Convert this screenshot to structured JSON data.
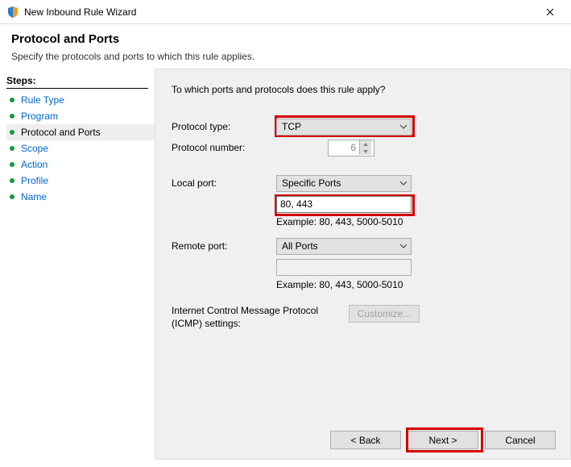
{
  "window": {
    "title": "New Inbound Rule Wizard"
  },
  "header": {
    "title": "Protocol and Ports",
    "subtitle": "Specify the protocols and ports to which this rule applies."
  },
  "sidebar": {
    "title": "Steps:",
    "items": [
      {
        "label": "Rule Type",
        "current": false
      },
      {
        "label": "Program",
        "current": false
      },
      {
        "label": "Protocol and Ports",
        "current": true
      },
      {
        "label": "Scope",
        "current": false
      },
      {
        "label": "Action",
        "current": false
      },
      {
        "label": "Profile",
        "current": false
      },
      {
        "label": "Name",
        "current": false
      }
    ]
  },
  "main": {
    "prompt": "To which ports and protocols does this rule apply?",
    "protocol_type_label": "Protocol type:",
    "protocol_type_value": "TCP",
    "protocol_number_label": "Protocol number:",
    "protocol_number_value": "6",
    "local_port_label": "Local port:",
    "local_port_mode": "Specific Ports",
    "local_port_value": "80, 443",
    "local_port_example": "Example: 80, 443, 5000-5010",
    "remote_port_label": "Remote port:",
    "remote_port_mode": "All Ports",
    "remote_port_value": "",
    "remote_port_example": "Example: 80, 443, 5000-5010",
    "icmp_label": "Internet Control Message Protocol (ICMP) settings:",
    "customize_label": "Customize..."
  },
  "buttons": {
    "back": "< Back",
    "next": "Next >",
    "cancel": "Cancel"
  }
}
